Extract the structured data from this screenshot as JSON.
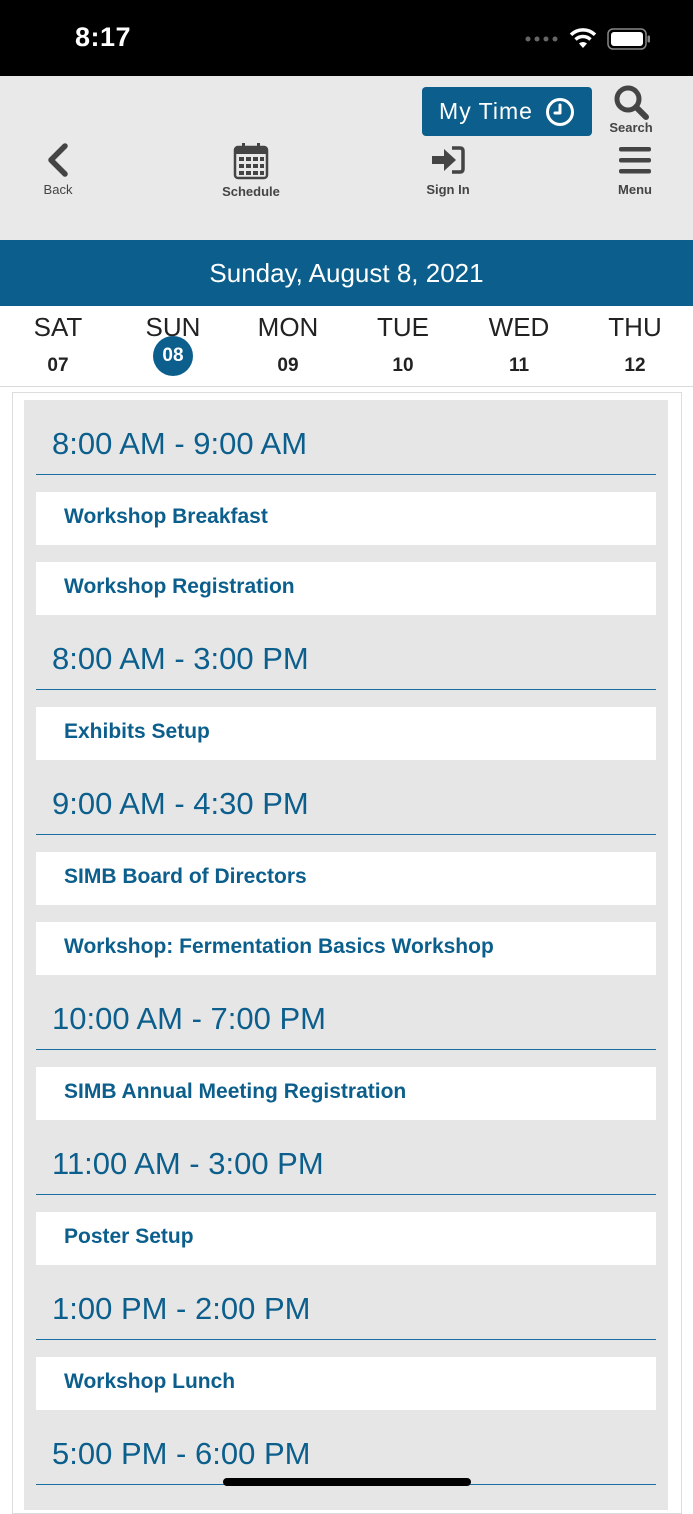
{
  "status_bar": {
    "time": "8:17"
  },
  "toolbar": {
    "mytime_label": "My Time",
    "search_label": "Search",
    "back_label": "Back",
    "schedule_label": "Schedule",
    "signin_label": "Sign In",
    "menu_label": "Menu"
  },
  "date_banner": {
    "text": "Sunday, August 8, 2021"
  },
  "days": [
    {
      "name": "SAT",
      "num": "07",
      "active": false
    },
    {
      "name": "SUN",
      "num": "08",
      "active": true
    },
    {
      "name": "MON",
      "num": "09",
      "active": false
    },
    {
      "name": "TUE",
      "num": "10",
      "active": false
    },
    {
      "name": "WED",
      "num": "11",
      "active": false
    },
    {
      "name": "THU",
      "num": "12",
      "active": false
    }
  ],
  "schedule": [
    {
      "time": "8:00 AM - 9:00 AM",
      "events": [
        "Workshop Breakfast",
        "Workshop Registration"
      ]
    },
    {
      "time": "8:00 AM - 3:00 PM",
      "events": [
        "Exhibits Setup"
      ]
    },
    {
      "time": "9:00 AM - 4:30 PM",
      "events": [
        "SIMB Board of Directors",
        "Workshop: Fermentation Basics Workshop"
      ]
    },
    {
      "time": "10:00 AM - 7:00 PM",
      "events": [
        "SIMB Annual Meeting Registration"
      ]
    },
    {
      "time": "11:00 AM - 3:00 PM",
      "events": [
        "Poster Setup"
      ]
    },
    {
      "time": "1:00 PM - 2:00 PM",
      "events": [
        "Workshop Lunch"
      ]
    },
    {
      "time": "5:00 PM - 6:00 PM",
      "events": []
    }
  ],
  "colors": {
    "accent": "#0c5f8c",
    "panel_bg": "#e6e6e6",
    "toolbar_bg": "#e9e9e9"
  }
}
